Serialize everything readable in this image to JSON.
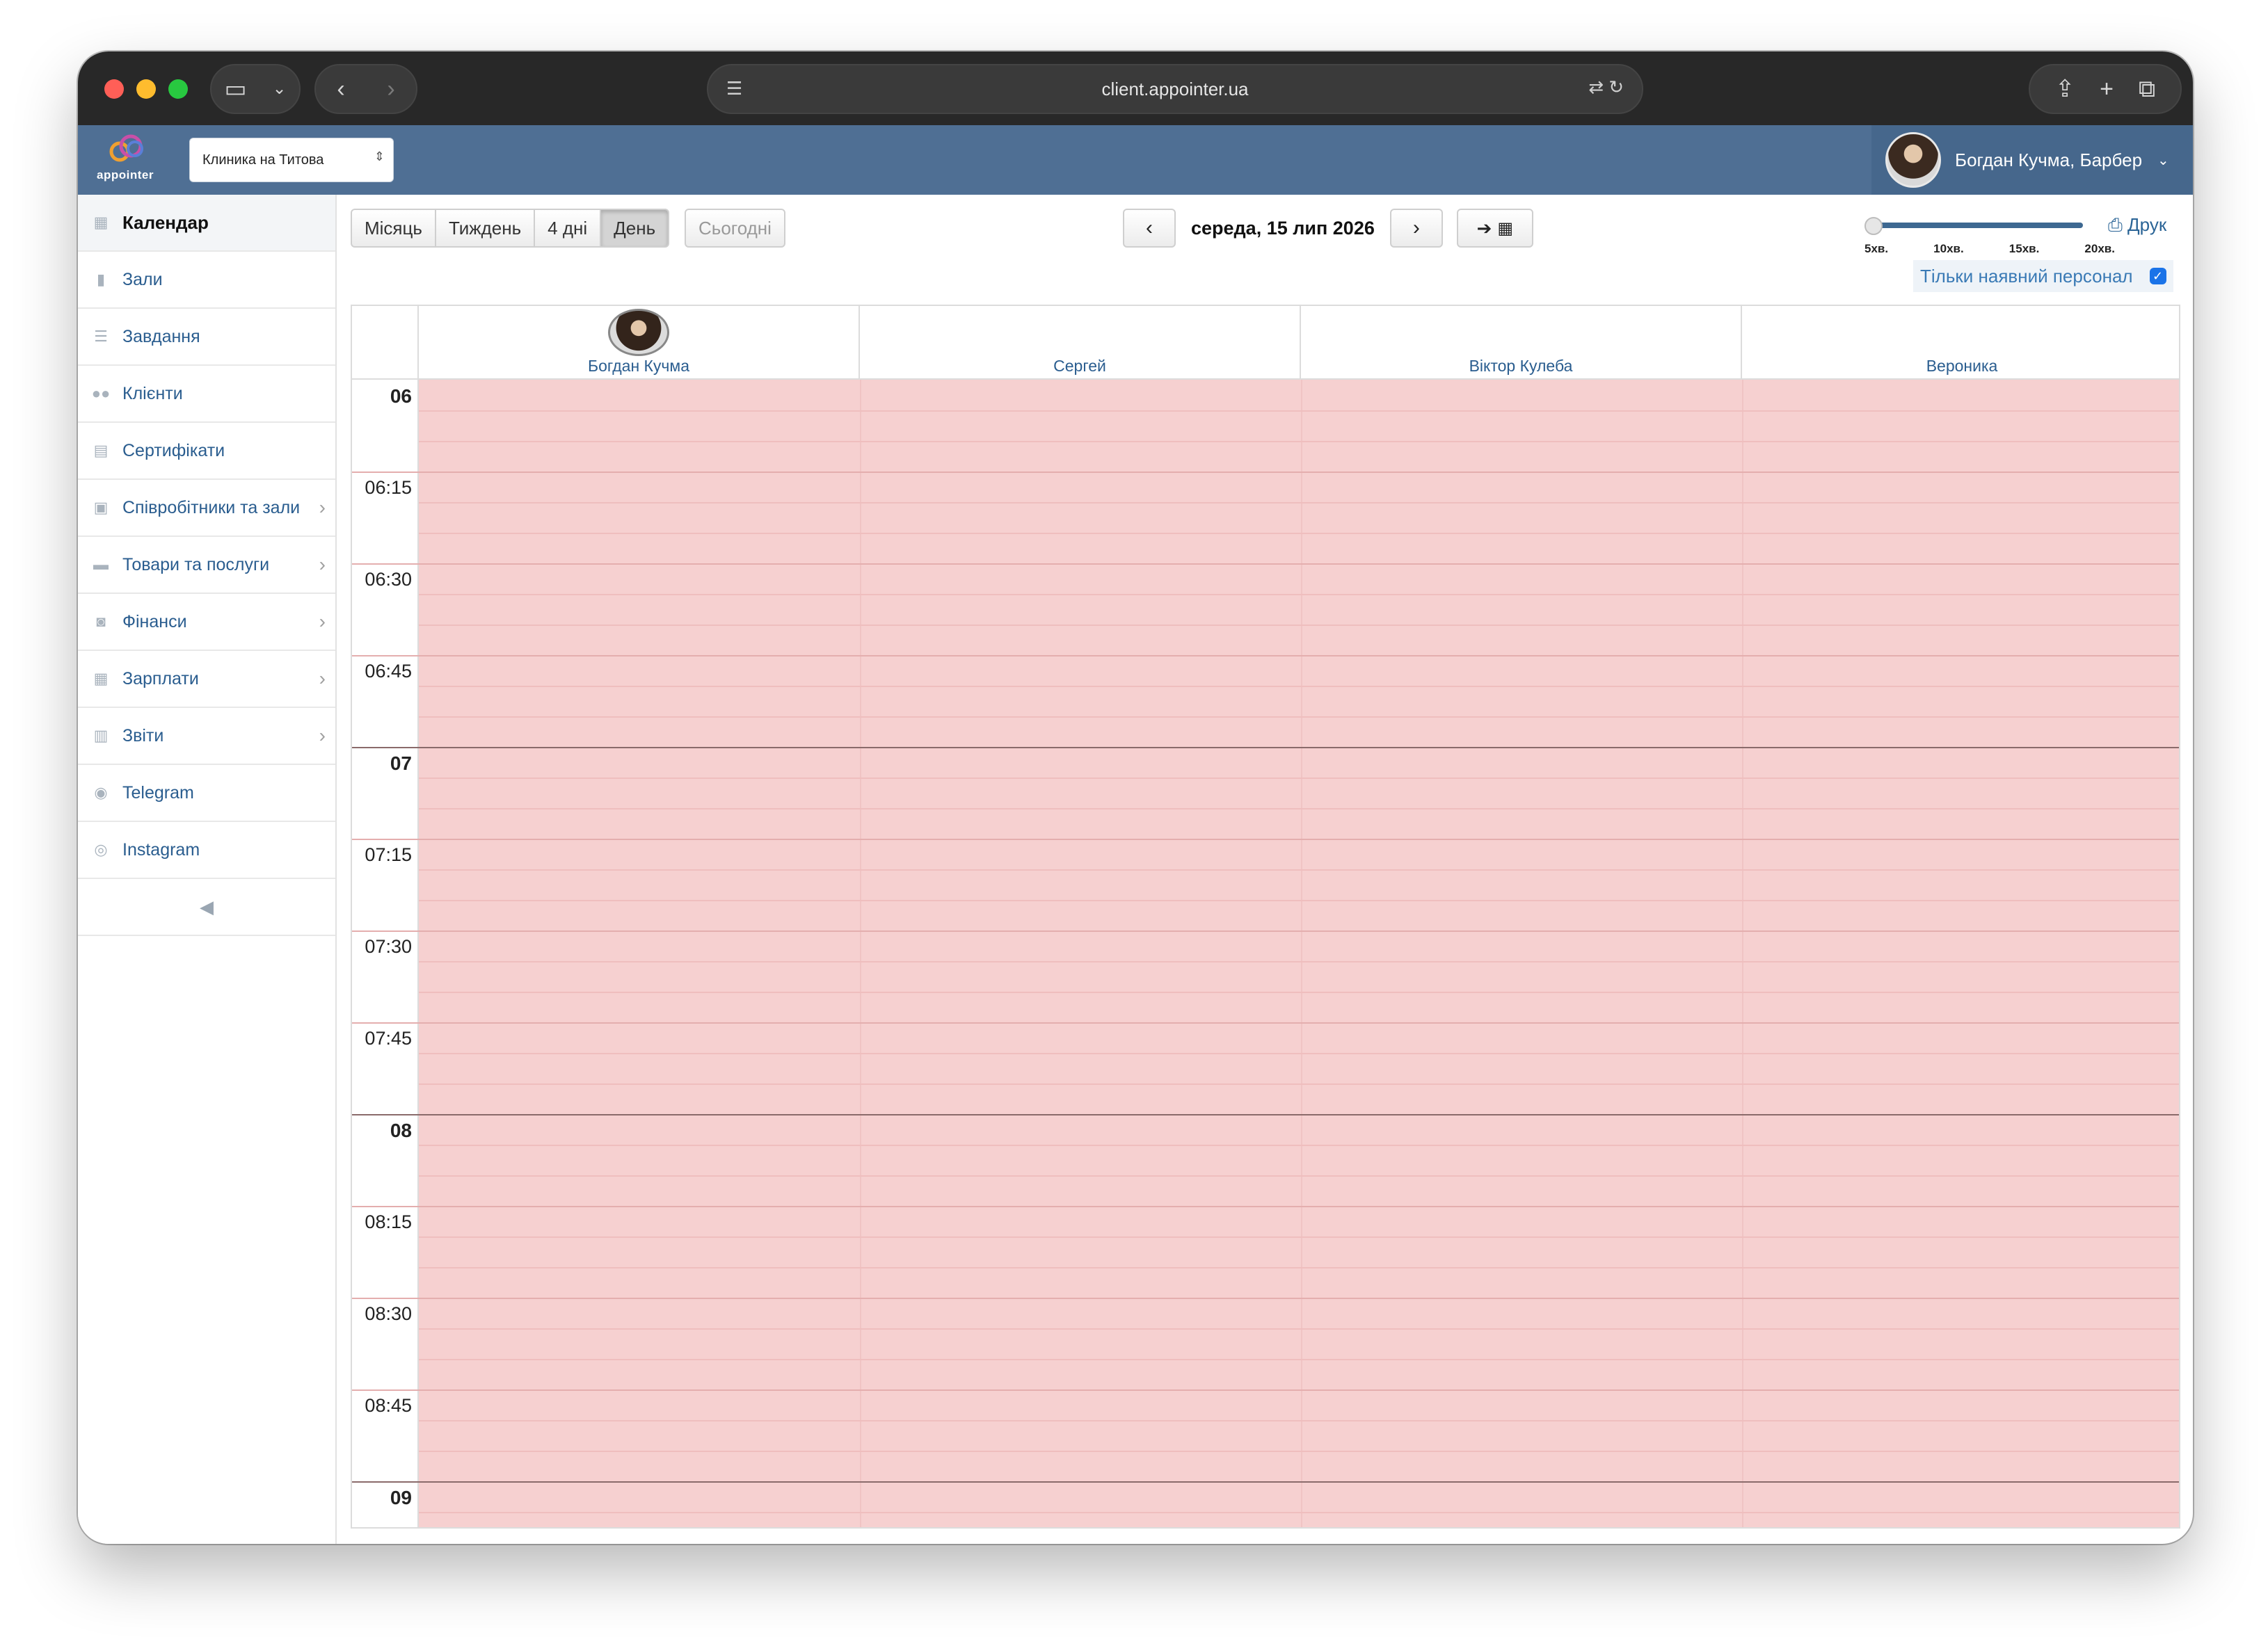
{
  "browser": {
    "url": "client.appointer.ua"
  },
  "header": {
    "logo_text": "appointer",
    "clinic": "Клиника на Титова",
    "user": "Богдан Кучма, Барбер"
  },
  "sidebar": {
    "items": [
      {
        "label": "Календар",
        "icon": "calendar-icon",
        "active": true
      },
      {
        "label": "Зали",
        "icon": "bookmark-icon"
      },
      {
        "label": "Завдання",
        "icon": "tasks-icon"
      },
      {
        "label": "Клієнти",
        "icon": "users-icon"
      },
      {
        "label": "Сертифікати",
        "icon": "certificate-icon"
      },
      {
        "label": "Співробітники та зали",
        "icon": "id-card-icon",
        "submenu": true
      },
      {
        "label": "Товари та послуги",
        "icon": "credit-card-icon",
        "submenu": true
      },
      {
        "label": "Фінанси",
        "icon": "money-icon",
        "submenu": true
      },
      {
        "label": "Зарплати",
        "icon": "calculator-icon",
        "submenu": true
      },
      {
        "label": "Звіти",
        "icon": "bar-chart-icon",
        "submenu": true
      },
      {
        "label": "Telegram",
        "icon": "telegram-icon"
      },
      {
        "label": "Instagram",
        "icon": "instagram-icon"
      }
    ]
  },
  "toolbar": {
    "views": [
      "Місяць",
      "Тиждень",
      "4 дні",
      "День"
    ],
    "active_view": "День",
    "today": "Сьогодні",
    "date": "середа, 15 лип 2026",
    "print": "Друк",
    "slider_ticks": [
      "5хв.",
      "10хв.",
      "15хв.",
      "20хв."
    ],
    "available_only": "Тільки наявний персонал"
  },
  "calendar": {
    "staff": [
      "Богдан Кучма",
      "Сергей",
      "Віктор Кулеба",
      "Вероника"
    ],
    "time_slots": [
      {
        "label": "06",
        "hour": true
      },
      {
        "label": "06:15"
      },
      {
        "label": "06:30"
      },
      {
        "label": "06:45"
      },
      {
        "label": "07",
        "hour": true
      },
      {
        "label": "07:15"
      },
      {
        "label": "07:30"
      },
      {
        "label": "07:45"
      },
      {
        "label": "08",
        "hour": true
      },
      {
        "label": "08:15"
      },
      {
        "label": "08:30"
      },
      {
        "label": "08:45"
      },
      {
        "label": "09",
        "hour": true
      }
    ],
    "unavailable_color": "#f6d0d0"
  }
}
